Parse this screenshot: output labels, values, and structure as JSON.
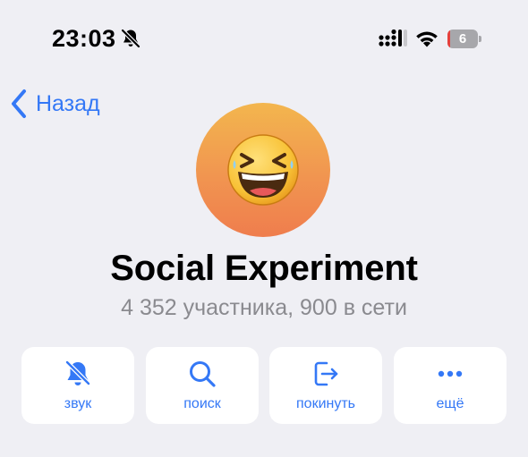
{
  "status_bar": {
    "time": "23:03",
    "icons": [
      "bell-slash-icon",
      "signal-icon",
      "wifi-icon",
      "battery-icon"
    ],
    "battery_percent": "6",
    "battery_level": 0.06,
    "battery_color": "#e6403c"
  },
  "nav": {
    "back_label": "Назад",
    "back_icon": "chevron-left-icon"
  },
  "avatar": {
    "icon": "laughing-face-emoji",
    "gradient_top": "#f3b64e",
    "gradient_bottom": "#ef7d4d"
  },
  "chat": {
    "title": "Social Experiment",
    "subtitle": "4 352 участника, 900 в сети"
  },
  "actions": [
    {
      "label": "звук",
      "icon": "bell-slash-icon"
    },
    {
      "label": "поиск",
      "icon": "search-icon"
    },
    {
      "label": "покинуть",
      "icon": "leave-icon"
    },
    {
      "label": "ещё",
      "icon": "more-dots-icon"
    }
  ],
  "colors": {
    "accent": "#3478f6",
    "background": "#efeff4",
    "secondary_text": "#8a8a8f"
  }
}
